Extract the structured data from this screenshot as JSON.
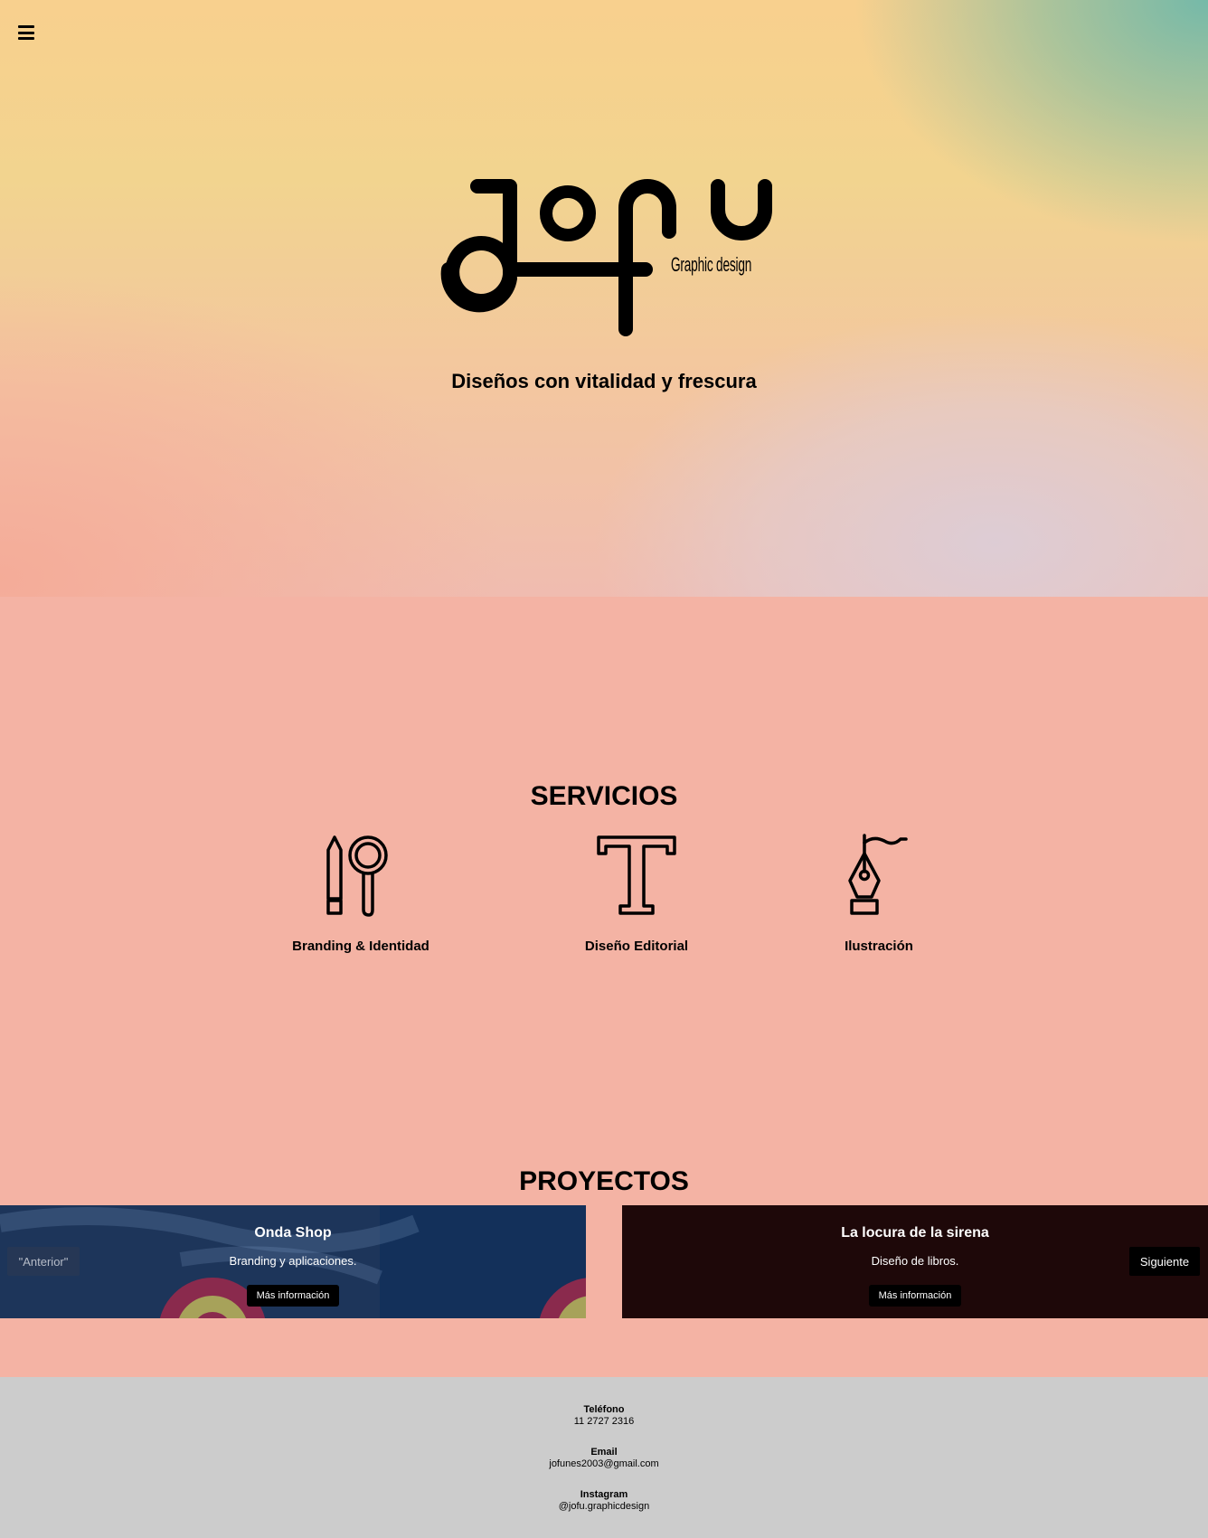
{
  "header": {
    "menu_icon": "hamburger-menu-icon",
    "brand_logo_text": "jofu",
    "brand_subtitle": "Graphic design",
    "tagline": "Diseños con vitalidad y frescura"
  },
  "services": {
    "title": "SERVICIOS",
    "items": [
      {
        "label": "Branding & Identidad",
        "icon": "pencil-magnifier-icon"
      },
      {
        "label": "Diseño Editorial",
        "icon": "letter-t-icon"
      },
      {
        "label": "Ilustración",
        "icon": "fountain-pen-nib-icon"
      }
    ]
  },
  "projects": {
    "title": "PROYECTOS",
    "prev_label": "\"Anterior\"",
    "next_label": "Siguiente",
    "slides": [
      {
        "title": "Onda Shop",
        "subtitle": "Branding y aplicaciones.",
        "button": "Más información"
      },
      {
        "title": "La locura de la sirena",
        "subtitle": "Diseño de libros.",
        "button": "Más información"
      }
    ]
  },
  "footer": {
    "phone_label": "Teléfono",
    "phone_value": "11 2727 2316",
    "email_label": "Email",
    "email_value": "jofunes2003@gmail.com",
    "instagram_label": "Instagram",
    "instagram_value": "@jofu.graphicdesign"
  },
  "colors": {
    "services_bg": "#f4b3a4",
    "footer_bg": "#cccccc",
    "slide_1_bg": "#1d355a",
    "slide_2_bg": "#1e0809"
  }
}
